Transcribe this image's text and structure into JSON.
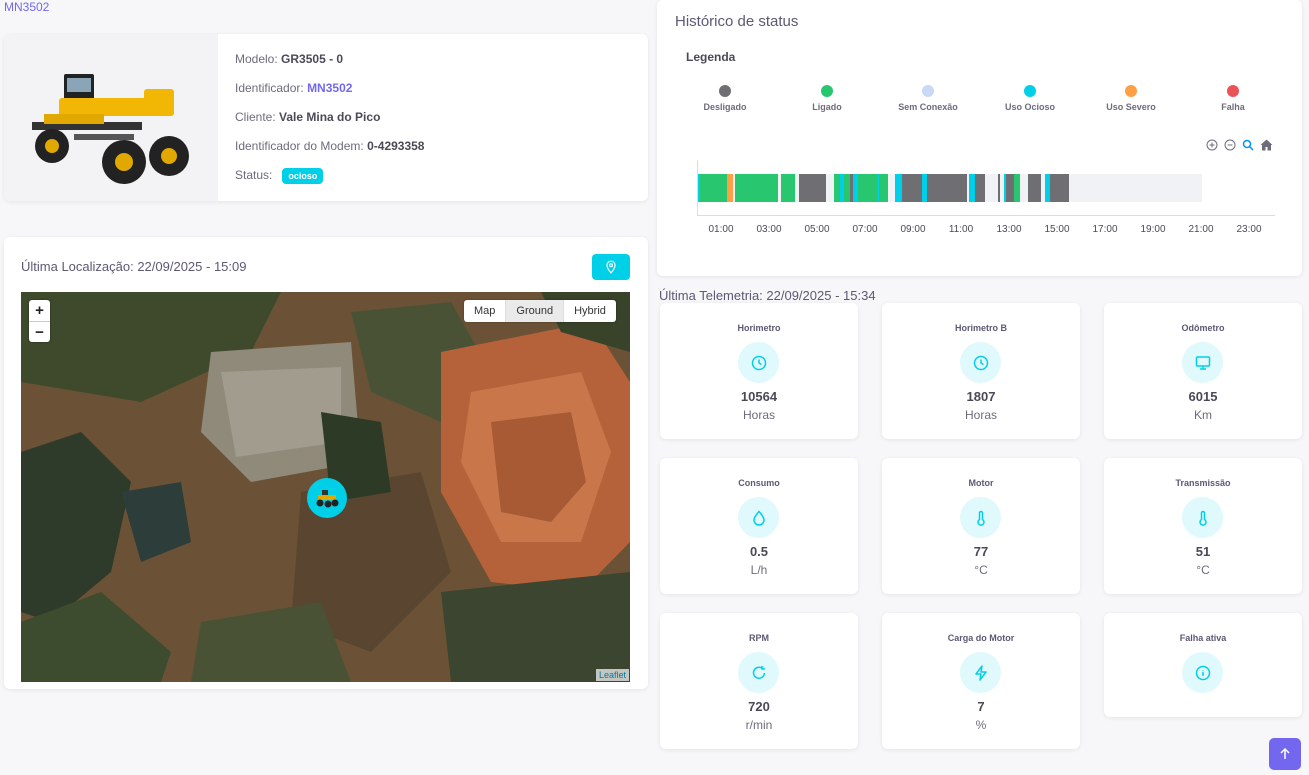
{
  "breadcrumb": "MN3502",
  "equipment": {
    "model_label": "Modelo:",
    "model": "GR3505 - 0",
    "id_label": "Identificador:",
    "id": "MN3502",
    "client_label": "Cliente:",
    "client": "Vale Mina do Pico",
    "modem_label": "Identificador do Modem:",
    "modem": "0-4293358",
    "status_label": "Status:",
    "status": "ocioso"
  },
  "location": {
    "title": "Última Localização: 22/09/2025 - 15:09",
    "map_types": [
      "Map",
      "Ground",
      "Hybrid"
    ],
    "active_map_type": "Ground",
    "zoom_in": "+",
    "zoom_out": "−",
    "attribution": "Leaflet"
  },
  "history": {
    "title": "Histórico de status",
    "legend_title": "Legenda",
    "legend": [
      {
        "label": "Desligado",
        "color": "#6e6e73"
      },
      {
        "label": "Ligado",
        "color": "#28c76f"
      },
      {
        "label": "Sem Conexão",
        "color": "#c9d8f5"
      },
      {
        "label": "Uso Ocioso",
        "color": "#00cfe8"
      },
      {
        "label": "Uso Severo",
        "color": "#ff9f43"
      },
      {
        "label": "Falha",
        "color": "#ea5455"
      }
    ],
    "ticks": [
      "01:00",
      "03:00",
      "05:00",
      "07:00",
      "09:00",
      "11:00",
      "13:00",
      "15:00",
      "17:00",
      "19:00",
      "21:00",
      "23:00"
    ],
    "segments": [
      {
        "start": 0.0,
        "end": 0.1,
        "status": "Uso Ocioso"
      },
      {
        "start": 0.1,
        "end": 1.2,
        "status": "Ligado"
      },
      {
        "start": 1.2,
        "end": 1.45,
        "status": "Uso Severo"
      },
      {
        "start": 1.45,
        "end": 1.55,
        "status": "Sem Conexão"
      },
      {
        "start": 1.55,
        "end": 3.35,
        "status": "Ligado"
      },
      {
        "start": 3.35,
        "end": 3.45,
        "status": "Sem Conexão"
      },
      {
        "start": 3.45,
        "end": 4.05,
        "status": "Ligado"
      },
      {
        "start": 4.05,
        "end": 4.2,
        "status": "Sem Conexão"
      },
      {
        "start": 4.2,
        "end": 5.35,
        "status": "Desligado"
      },
      {
        "start": 5.35,
        "end": 5.65,
        "status": "Sem Conexão"
      },
      {
        "start": 5.65,
        "end": 5.9,
        "status": "Ligado"
      },
      {
        "start": 5.9,
        "end": 6.1,
        "status": "Uso Ocioso"
      },
      {
        "start": 6.1,
        "end": 6.35,
        "status": "Ligado"
      },
      {
        "start": 6.35,
        "end": 6.45,
        "status": "Desligado"
      },
      {
        "start": 6.45,
        "end": 6.65,
        "status": "Uso Ocioso"
      },
      {
        "start": 6.65,
        "end": 7.5,
        "status": "Ligado"
      },
      {
        "start": 7.5,
        "end": 7.55,
        "status": "Uso Ocioso"
      },
      {
        "start": 7.55,
        "end": 7.9,
        "status": "Ligado"
      },
      {
        "start": 7.9,
        "end": 8.2,
        "status": "Sem Conexão"
      },
      {
        "start": 8.2,
        "end": 8.5,
        "status": "Uso Ocioso"
      },
      {
        "start": 8.5,
        "end": 9.35,
        "status": "Desligado"
      },
      {
        "start": 9.35,
        "end": 9.55,
        "status": "Uso Ocioso"
      },
      {
        "start": 9.55,
        "end": 11.2,
        "status": "Desligado"
      },
      {
        "start": 11.2,
        "end": 11.3,
        "status": "Sem Conexão"
      },
      {
        "start": 11.3,
        "end": 11.55,
        "status": "Uso Ocioso"
      },
      {
        "start": 11.55,
        "end": 11.95,
        "status": "Desligado"
      },
      {
        "start": 11.95,
        "end": 12.5,
        "status": "Sem Conexão"
      },
      {
        "start": 12.5,
        "end": 12.6,
        "status": "Desligado"
      },
      {
        "start": 12.6,
        "end": 12.75,
        "status": "Sem Conexão"
      },
      {
        "start": 12.75,
        "end": 12.85,
        "status": "Uso Ocioso"
      },
      {
        "start": 12.85,
        "end": 13.15,
        "status": "Desligado"
      },
      {
        "start": 13.15,
        "end": 13.4,
        "status": "Ligado"
      },
      {
        "start": 13.4,
        "end": 13.75,
        "status": "Sem Conexão"
      },
      {
        "start": 13.75,
        "end": 14.3,
        "status": "Desligado"
      },
      {
        "start": 14.3,
        "end": 14.45,
        "status": "Sem Conexão"
      },
      {
        "start": 14.45,
        "end": 14.65,
        "status": "Uso Ocioso"
      },
      {
        "start": 14.65,
        "end": 15.45,
        "status": "Desligado"
      },
      {
        "start": 15.45,
        "end": 21.0,
        "status": "Sem Conexão"
      }
    ]
  },
  "telemetry": {
    "title": "Última Telemetria: 22/09/2025 - 15:34",
    "tiles": [
      {
        "name": "Horimetro",
        "value": "10564",
        "unit": "Horas",
        "icon": "clock-icon"
      },
      {
        "name": "Horimetro B",
        "value": "1807",
        "unit": "Horas",
        "icon": "clock-icon"
      },
      {
        "name": "Odômetro",
        "value": "6015",
        "unit": "Km",
        "icon": "screen-icon"
      },
      {
        "name": "Consumo",
        "value": "0.5",
        "unit": "L/h",
        "icon": "droplet-icon"
      },
      {
        "name": "Motor",
        "value": "77",
        "unit": "°C",
        "icon": "thermometer-icon"
      },
      {
        "name": "Transmissão",
        "value": "51",
        "unit": "°C",
        "icon": "thermometer-icon"
      },
      {
        "name": "RPM",
        "value": "720",
        "unit": "r/min",
        "icon": "refresh-icon"
      },
      {
        "name": "Carga do Motor",
        "value": "7",
        "unit": "%",
        "icon": "bolt-icon"
      },
      {
        "name": "Falha ativa",
        "value": "",
        "unit": "",
        "icon": "info-icon"
      }
    ]
  },
  "colors": {
    "accent": "#7367f0",
    "cyan": "#00cfe8"
  }
}
